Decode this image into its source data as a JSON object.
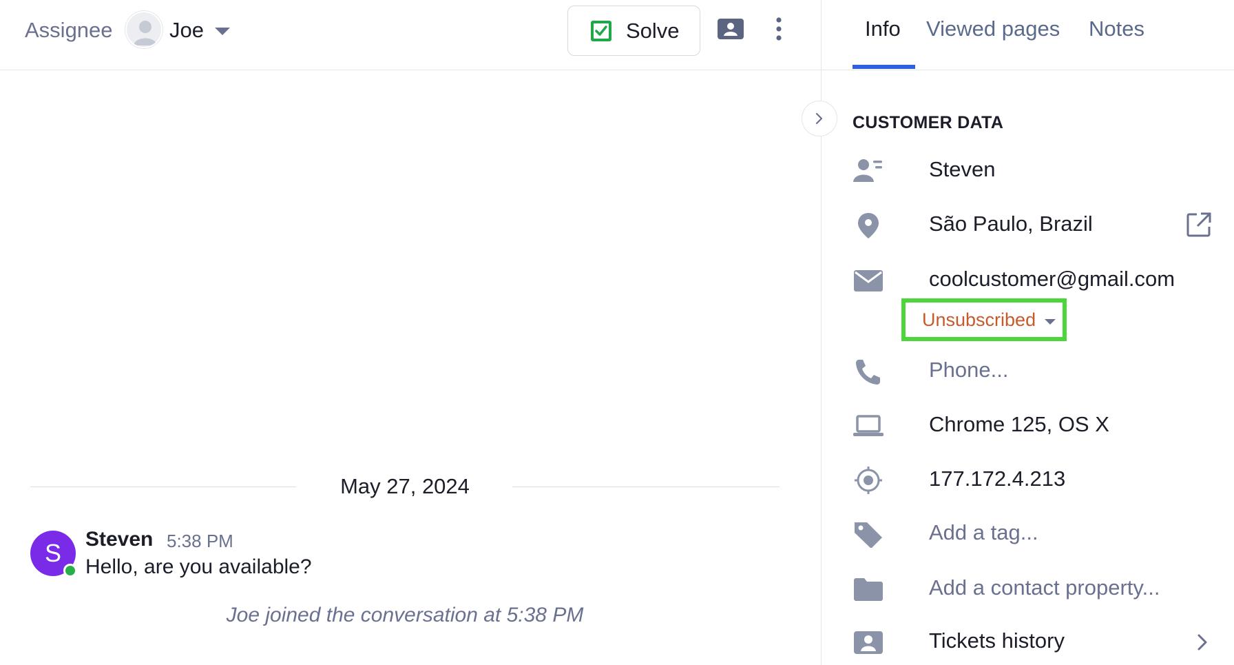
{
  "header": {
    "assignee_label": "Assignee",
    "assignee_name": "Joe",
    "solve_label": "Solve"
  },
  "conversation": {
    "date": "May 27, 2024",
    "message": {
      "avatar_letter": "S",
      "author": "Steven",
      "time": "5:38 PM",
      "text": "Hello, are you available?"
    },
    "system_note": "Joe joined the conversation at 5:38 PM"
  },
  "sidebar": {
    "tabs": [
      {
        "label": "Info",
        "active": true
      },
      {
        "label": "Viewed pages",
        "active": false
      },
      {
        "label": "Notes",
        "active": false
      }
    ],
    "section_title": "CUSTOMER DATA",
    "fields": {
      "name": "Steven",
      "location": "São Paulo, Brazil",
      "email": "coolcustomer@gmail.com",
      "subscription": "Unsubscribed",
      "phone_placeholder": "Phone...",
      "browser": "Chrome 125, OS X",
      "ip": "177.172.4.213",
      "tag_placeholder": "Add a tag...",
      "property_placeholder": "Add a contact property...",
      "tickets_history": "Tickets history"
    }
  },
  "colors": {
    "accent": "#2f5fe0",
    "muted_text": "#6a7190",
    "icon": "#8a93a8",
    "avatar": "#7a2be8",
    "online": "#27b04a",
    "solve_check": "#1fa84a",
    "highlight": "#4cd63a",
    "unsubscribed_text": "#c8592a"
  }
}
